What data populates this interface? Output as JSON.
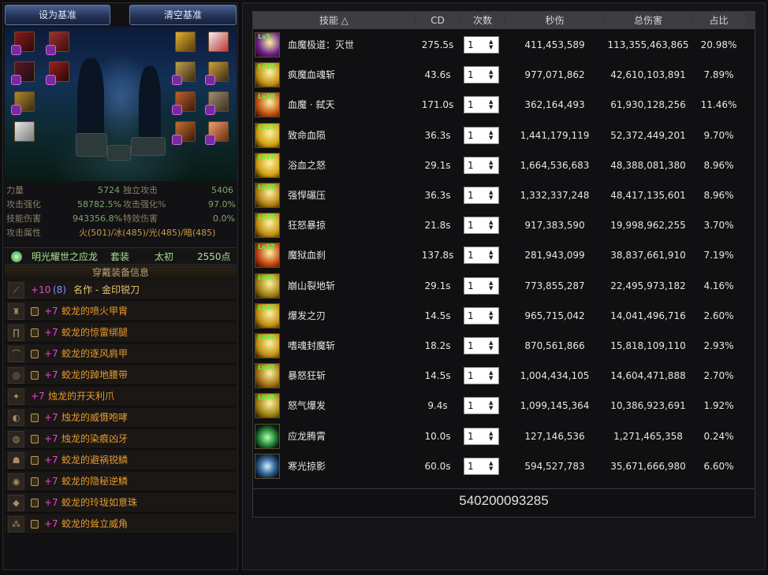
{
  "buttons": {
    "set_baseline": "设为基准",
    "clear_baseline": "清空基准"
  },
  "stats": [
    {
      "label": "力量",
      "value": "5724",
      "label2": "独立攻击",
      "value2": "5406"
    },
    {
      "label": "攻击强化",
      "value": "58782.5%",
      "label2": "攻击强化%",
      "value2": "97.0%"
    },
    {
      "label": "技能伤害",
      "value": "943356.8%",
      "label2": "特效伤害",
      "value2": "0.0%"
    }
  ],
  "element": {
    "label": "攻击属性",
    "value": "火(501)/冰(485)/光(485)/暗(485)"
  },
  "suit": {
    "name": "明光耀世之应龙",
    "type": "套装",
    "grade": "太初",
    "points": "2550点"
  },
  "equip_header": "穿戴装备信息",
  "equipment": [
    {
      "plus": "+10",
      "extra": "(8)",
      "name": "名作 - 金印锐刀",
      "icon": "blade-icon"
    },
    {
      "plus": "+7",
      "name": "蛟龙的喷火甲胄",
      "icon": "armor-icon",
      "locked": true
    },
    {
      "plus": "+7",
      "name": "蛟龙的惊雷绑腿",
      "icon": "leggings-icon",
      "locked": true
    },
    {
      "plus": "+7",
      "name": "蛟龙的逐风肩甲",
      "icon": "shoulder-icon",
      "locked": true
    },
    {
      "plus": "+7",
      "name": "蛟龙的踔地腰带",
      "icon": "belt-icon",
      "locked": true
    },
    {
      "plus": "+7",
      "name": "烛龙的开天利爪",
      "icon": "claw-icon"
    },
    {
      "plus": "+7",
      "name": "烛龙的威慑咆哮",
      "icon": "roar-icon",
      "locked": true
    },
    {
      "plus": "+7",
      "name": "烛龙的染痕凶牙",
      "icon": "fang-icon",
      "locked": true
    },
    {
      "plus": "+7",
      "name": "蛟龙的避祸锐鳞",
      "icon": "scale-icon",
      "locked": true
    },
    {
      "plus": "+7",
      "name": "蛟龙的隐秘逆鳞",
      "icon": "reverse-scale-icon",
      "locked": true
    },
    {
      "plus": "+7",
      "name": "蛟龙的玲珑如意珠",
      "icon": "pearl-icon",
      "locked": true
    },
    {
      "plus": "+7",
      "name": "蛟龙的耸立威角",
      "icon": "horn-icon",
      "locked": true
    }
  ],
  "table": {
    "headers": {
      "skill": "技能 △",
      "cd": "CD",
      "count": "次数",
      "dps": "秒伤",
      "total": "总伤害",
      "ratio": "占比"
    },
    "rows": [
      {
        "lv": "Lv5",
        "name": "血魔极道：灭世",
        "cd": "275.5s",
        "count": "1",
        "dps": "411,453,589",
        "total": "113,355,463,865",
        "ratio": "20.98%",
        "icon": "blood-magic-icon"
      },
      {
        "lv": "Lv15",
        "name": "疯魔血魂斩",
        "cd": "43.6s",
        "count": "1",
        "dps": "977,071,862",
        "total": "42,610,103,891",
        "ratio": "7.89%",
        "icon": "burst-icon"
      },
      {
        "lv": "Lv10",
        "name": "血魔 · 弑天",
        "cd": "171.0s",
        "count": "1",
        "dps": "362,164,493",
        "total": "61,930,128,256",
        "ratio": "11.46%",
        "icon": "demon-icon"
      },
      {
        "lv": "Lv23",
        "name": "致命血陨",
        "cd": "36.3s",
        "count": "1",
        "dps": "1,441,179,119",
        "total": "52,372,449,201",
        "ratio": "9.70%",
        "icon": "meteor-icon"
      },
      {
        "lv": "Lv27",
        "name": "浴血之怒",
        "cd": "29.1s",
        "count": "1",
        "dps": "1,664,536,683",
        "total": "48,388,081,380",
        "ratio": "8.96%",
        "icon": "rage-icon"
      },
      {
        "lv": "Lv28",
        "name": "强悍碾压",
        "cd": "36.3s",
        "count": "1",
        "dps": "1,332,337,248",
        "total": "48,417,135,601",
        "ratio": "8.96%",
        "icon": "crush-icon"
      },
      {
        "lv": "Lv33",
        "name": "狂怒暴掠",
        "cd": "21.8s",
        "count": "1",
        "dps": "917,383,590",
        "total": "19,998,962,255",
        "ratio": "3.70%",
        "icon": "fury-icon"
      },
      {
        "lv": "Lv17",
        "name": "魔狱血刹",
        "cd": "137.8s",
        "count": "1",
        "dps": "281,943,099",
        "total": "38,837,661,910",
        "ratio": "7.19%",
        "icon": "hell-icon"
      },
      {
        "lv": "Lv40",
        "name": "崩山裂地斩",
        "cd": "29.1s",
        "count": "1",
        "dps": "773,855,287",
        "total": "22,495,973,182",
        "ratio": "4.16%",
        "icon": "quake-icon"
      },
      {
        "lv": "Lv43",
        "name": "爆发之刃",
        "cd": "14.5s",
        "count": "1",
        "dps": "965,715,042",
        "total": "14,041,496,716",
        "ratio": "2.60%",
        "icon": "blade-burst-icon"
      },
      {
        "lv": "Lv45",
        "name": "嗜魂封魔斩",
        "cd": "18.2s",
        "count": "1",
        "dps": "870,561,866",
        "total": "15,818,109,110",
        "ratio": "2.93%",
        "icon": "soul-icon"
      },
      {
        "lv": "Lv45",
        "name": "暴怒狂斩",
        "cd": "14.5s",
        "count": "1",
        "dps": "1,004,434,105",
        "total": "14,604,471,888",
        "ratio": "2.70%",
        "icon": "berserk-icon"
      },
      {
        "lv": "Lv48",
        "name": "怒气爆发",
        "cd": "9.4s",
        "count": "1",
        "dps": "1,099,145,364",
        "total": "10,386,923,691",
        "ratio": "1.92%",
        "icon": "explosion-icon"
      },
      {
        "lv": "",
        "name": "应龙腾霄",
        "cd": "10.0s",
        "count": "1",
        "dps": "127,146,536",
        "total": "1,271,465,358",
        "ratio": "0.24%",
        "icon": "dragon-orb-icon"
      },
      {
        "lv": "",
        "name": "寒光掠影",
        "cd": "60.0s",
        "count": "1",
        "dps": "594,527,783",
        "total": "35,671,666,980",
        "ratio": "6.60%",
        "icon": "frost-slash-icon"
      }
    ],
    "total": "540200093285"
  },
  "colors": {
    "accent_green": "#4cff3c",
    "name_orange": "#e79a2c",
    "plus_pink": "#e24ad6"
  }
}
